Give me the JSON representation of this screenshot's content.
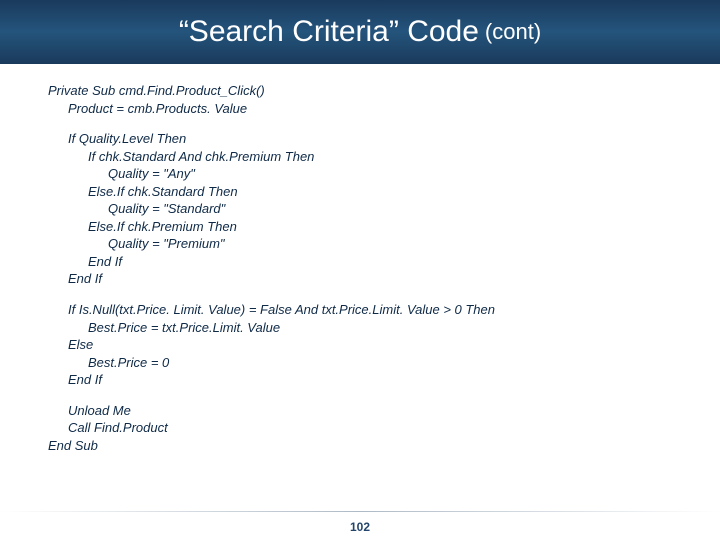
{
  "header": {
    "title_main": "“Search Criteria” Code",
    "title_cont": "(cont)"
  },
  "code": {
    "lines": [
      {
        "indent": 0,
        "text": "Private Sub cmd.Find.Product_Click()"
      },
      {
        "indent": 1,
        "text": "Product = cmb.Products. Value"
      },
      {
        "indent": 0,
        "text": ""
      },
      {
        "indent": 1,
        "text": "If Quality.Level Then"
      },
      {
        "indent": 2,
        "text": "If chk.Standard And chk.Premium Then"
      },
      {
        "indent": 3,
        "text": "Quality = \"Any\""
      },
      {
        "indent": 2,
        "text": "Else.If chk.Standard Then"
      },
      {
        "indent": 3,
        "text": "Quality = \"Standard\""
      },
      {
        "indent": 2,
        "text": "Else.If chk.Premium Then"
      },
      {
        "indent": 3,
        "text": "Quality = \"Premium\""
      },
      {
        "indent": 2,
        "text": "End If"
      },
      {
        "indent": 1,
        "text": "End If"
      },
      {
        "indent": 0,
        "text": ""
      },
      {
        "indent": 1,
        "text": "If Is.Null(txt.Price. Limit. Value) = False And txt.Price.Limit. Value > 0 Then"
      },
      {
        "indent": 2,
        "text": "Best.Price = txt.Price.Limit. Value"
      },
      {
        "indent": 1,
        "text": "Else"
      },
      {
        "indent": 2,
        "text": "Best.Price = 0"
      },
      {
        "indent": 1,
        "text": "End If"
      },
      {
        "indent": 0,
        "text": ""
      },
      {
        "indent": 1,
        "text": "Unload Me"
      },
      {
        "indent": 1,
        "text": "Call Find.Product"
      },
      {
        "indent": 0,
        "text": "End Sub"
      }
    ]
  },
  "footer": {
    "page_number": "102"
  }
}
